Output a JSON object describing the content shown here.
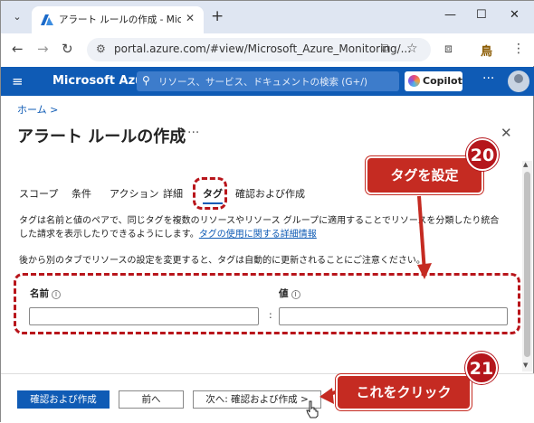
{
  "browser": {
    "tab_title": "アラート ルールの作成 - Microsoft A",
    "url": "portal.azure.com/#view/Microsoft_Azure_Monitoring/...",
    "profile_initial": "鳥"
  },
  "azure": {
    "brand": "Microsoft Azure",
    "search_placeholder": "リソース、サービス、ドキュメントの検索 (G+/)",
    "copilot_label": "Copilot"
  },
  "page": {
    "breadcrumb": "ホーム >",
    "title": "アラート ルールの作成",
    "tabs": [
      "スコープ",
      "条件",
      "アクション",
      "詳細",
      "タグ",
      "確認および作成"
    ],
    "active_tab": "タグ",
    "description": "タグは名前と値のペアで、同じタグを複数のリソースやリソース グループに適用することでリソースを分類したり統合した請求を表示したりできるようにします。",
    "description_link": "タグの使用に関する詳細情報",
    "note": "後から別のタブでリソースの設定を変更すると、タグは自動的に更新されることにご注意ください。",
    "name_label": "名前",
    "value_label": "値",
    "name_value": "",
    "value_value": "",
    "separator": ":"
  },
  "footer": {
    "review_create_label": "確認および作成",
    "previous_label": "前へ",
    "next_label": "次へ: 確認および作成 >"
  },
  "annotations": {
    "step20_number": "20",
    "step20_text": "タグを設定",
    "step21_number": "21",
    "step21_text": "これをクリック",
    "color": "#c52b22"
  }
}
